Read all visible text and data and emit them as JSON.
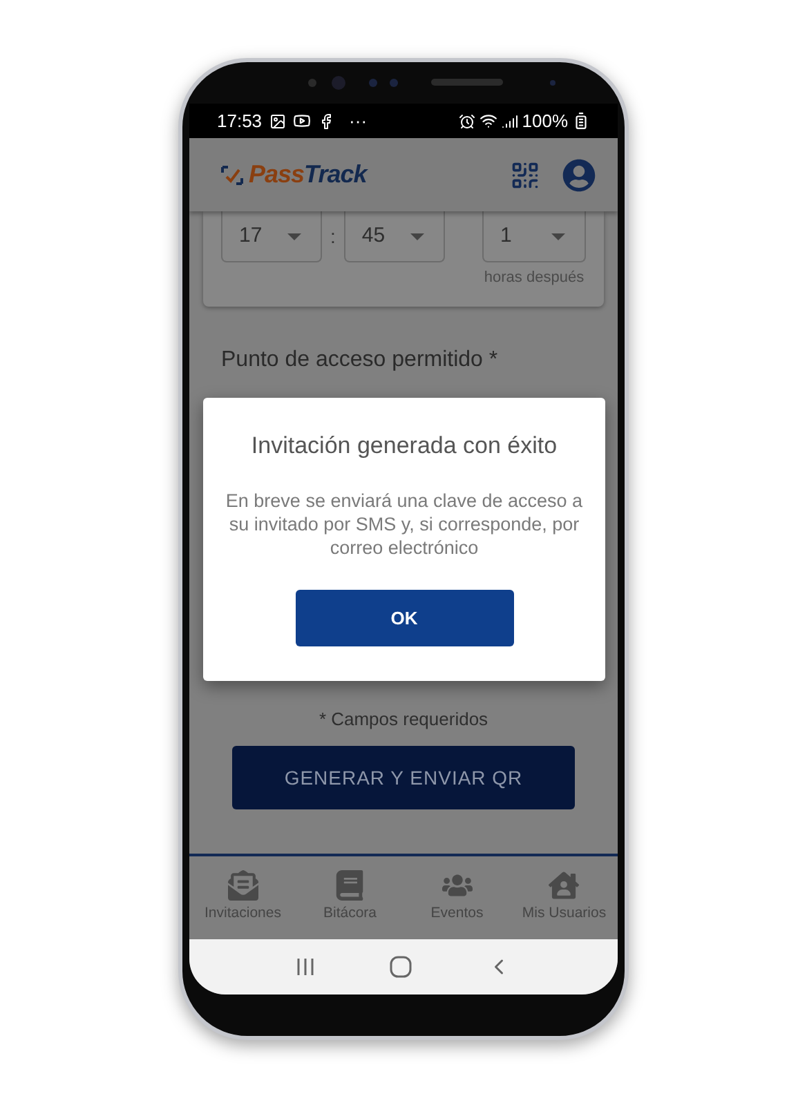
{
  "status_bar": {
    "time": "17:53",
    "more": "···",
    "battery": "100%"
  },
  "app_bar": {
    "logo_parts": [
      "Pass",
      "Track"
    ]
  },
  "time_fields": [
    {
      "value": "17"
    },
    {
      "value": "45"
    }
  ],
  "time_separator": ":",
  "duration_field": {
    "value": "1",
    "caption": "horas después"
  },
  "access_point_label": "Punto de acceso permitido *",
  "required_note": "* Campos requeridos",
  "submit_button": "GENERAR Y ENVIAR QR",
  "bottom_nav": [
    {
      "label": "Invitaciones",
      "kind": "invitations"
    },
    {
      "label": "Bitácora",
      "kind": "log"
    },
    {
      "label": "Eventos",
      "kind": "events"
    },
    {
      "label": "Mis Usuarios",
      "kind": "users"
    }
  ],
  "dialog": {
    "title": "Invitación generada con éxito",
    "message": "En breve se enviará una clave de acceso a su invitado por SMS y, si corresponde, por correo electrónico",
    "button": "OK"
  }
}
